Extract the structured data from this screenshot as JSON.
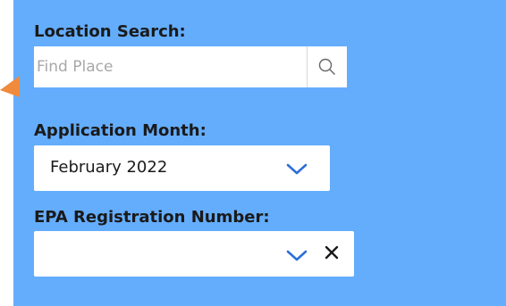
{
  "location_search": {
    "label": "Location Search:",
    "placeholder": "Find Place",
    "value": "",
    "search_icon": "search-icon"
  },
  "application_month": {
    "label": "Application Month:",
    "selected": "February 2022",
    "dropdown_icon": "chevron-down-icon"
  },
  "epa_registration": {
    "label": "EPA Registration Number:",
    "selected": "",
    "dropdown_icon": "chevron-down-icon",
    "clear_icon": "close-icon"
  },
  "colors": {
    "panel_background": "#64adfd",
    "pointer_arrow": "#f08a3c",
    "chevron": "#2e6fd8",
    "label_text": "#1a1a1a"
  }
}
